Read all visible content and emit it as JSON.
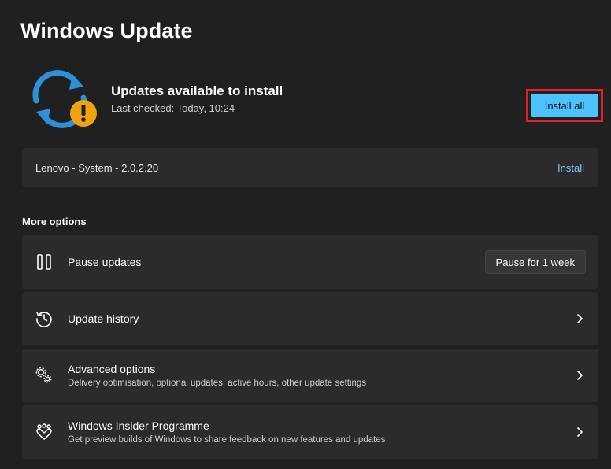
{
  "page": {
    "title": "Windows Update"
  },
  "status": {
    "title": "Updates available to install",
    "last_checked": "Last checked: Today, 10:24",
    "install_all_label": "Install all"
  },
  "pending_update": {
    "name": "Lenovo - System - 2.0.2.20",
    "action_label": "Install"
  },
  "more_options": {
    "heading": "More options",
    "pause": {
      "label": "Pause updates",
      "button_label": "Pause for 1 week"
    },
    "history": {
      "label": "Update history"
    },
    "advanced": {
      "label": "Advanced options",
      "description": "Delivery optimisation, optional updates, active hours, other update settings"
    },
    "insider": {
      "label": "Windows Insider Programme",
      "description": "Get preview builds of Windows to share feedback on new features and updates"
    }
  },
  "colors": {
    "accent": "#4cc2ff",
    "warning": "#f2a20e",
    "highlight_border": "#e0202a",
    "sync_blue": "#2f8fd8"
  }
}
